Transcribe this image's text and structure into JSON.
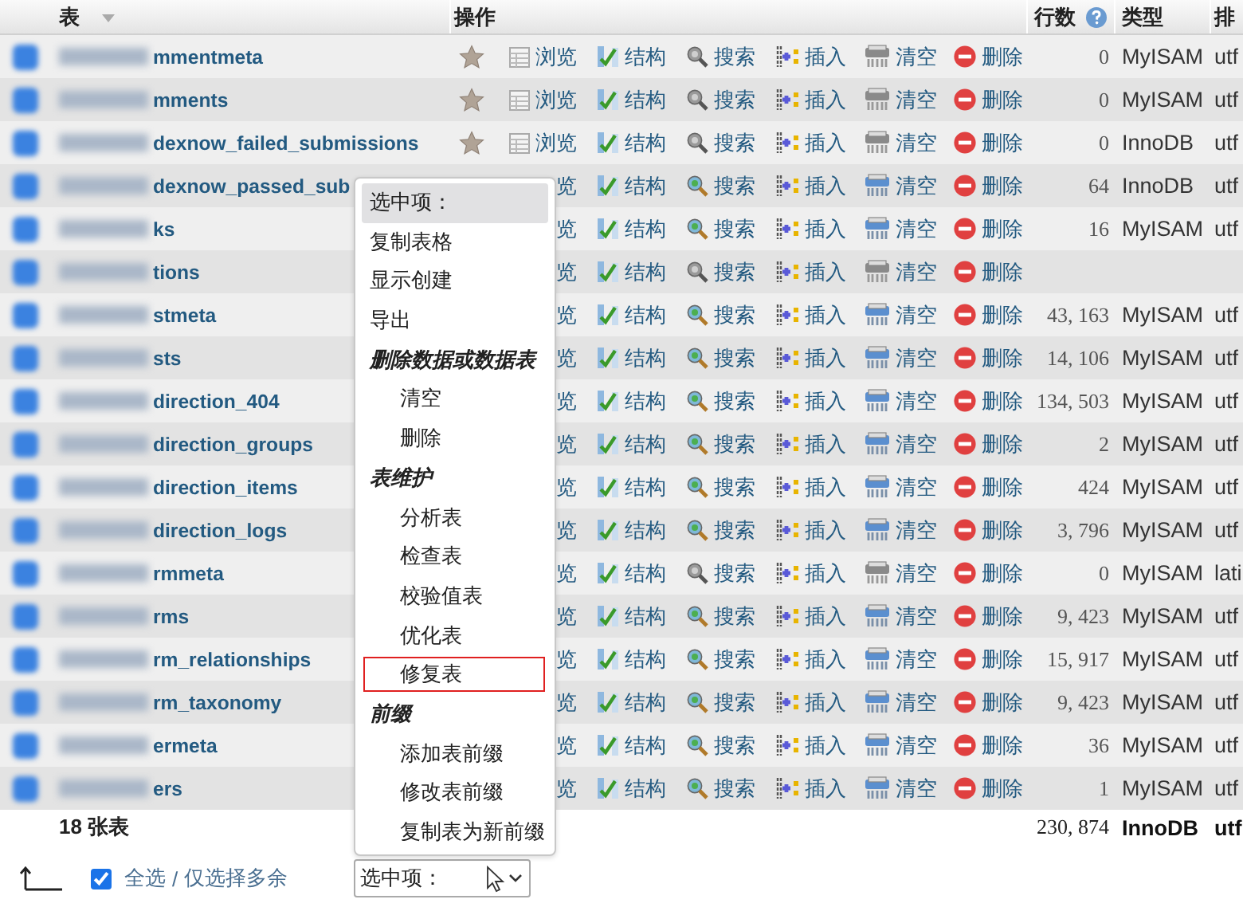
{
  "header": {
    "columns": [
      {
        "label": "表"
      },
      {
        "label": "操作"
      },
      {
        "label": "行数"
      },
      {
        "label": "类型"
      },
      {
        "label": "排"
      }
    ]
  },
  "rows": [
    {
      "name": "mmentmeta",
      "star_visible": true,
      "empty": true,
      "actions": [
        "浏览",
        "结构",
        "搜索",
        "插入",
        "清空",
        "删除"
      ],
      "count": "0",
      "type": "MyISAM",
      "collation": "utf"
    },
    {
      "name": "mments",
      "star_visible": true,
      "empty": true,
      "actions": [
        "浏览",
        "结构",
        "搜索",
        "插入",
        "清空",
        "删除"
      ],
      "count": "0",
      "type": "MyISAM",
      "collation": "utf"
    },
    {
      "name": "dexnow_failed_submissions",
      "star_visible": true,
      "empty": true,
      "actions": [
        "浏览",
        "结构",
        "搜索",
        "插入",
        "清空",
        "删除"
      ],
      "count": "0",
      "type": "InnoDB",
      "collation": "utf"
    },
    {
      "name": "dexnow_passed_sub",
      "star_visible": false,
      "empty": false,
      "actions": [
        "览",
        "结构",
        "搜索",
        "插入",
        "清空",
        "删除"
      ],
      "count": "64",
      "type": "InnoDB",
      "collation": "utf"
    },
    {
      "name": "ks",
      "star_visible": false,
      "empty": false,
      "actions": [
        "览",
        "结构",
        "搜索",
        "插入",
        "清空",
        "删除"
      ],
      "count": "16",
      "type": "MyISAM",
      "collation": "utf"
    },
    {
      "name": "tions",
      "star_visible": false,
      "empty": true,
      "actions": [
        "览",
        "结构",
        "搜索",
        "插入",
        "清空",
        "删除"
      ]
    },
    {
      "name": "stmeta",
      "star_visible": false,
      "empty": false,
      "actions": [
        "览",
        "结构",
        "搜索",
        "插入",
        "清空",
        "删除"
      ],
      "count": "43, 163",
      "type": "MyISAM",
      "collation": "utf"
    },
    {
      "name": "sts",
      "star_visible": false,
      "empty": false,
      "actions": [
        "览",
        "结构",
        "搜索",
        "插入",
        "清空",
        "删除"
      ],
      "count": "14, 106",
      "type": "MyISAM",
      "collation": "utf"
    },
    {
      "name": "direction_404",
      "star_visible": false,
      "empty": false,
      "actions": [
        "览",
        "结构",
        "搜索",
        "插入",
        "清空",
        "删除"
      ],
      "count": "134, 503",
      "type": "MyISAM",
      "collation": "utf"
    },
    {
      "name": "direction_groups",
      "star_visible": false,
      "empty": false,
      "actions": [
        "览",
        "结构",
        "搜索",
        "插入",
        "清空",
        "删除"
      ],
      "count": "2",
      "type": "MyISAM",
      "collation": "utf"
    },
    {
      "name": "direction_items",
      "star_visible": false,
      "empty": false,
      "actions": [
        "览",
        "结构",
        "搜索",
        "插入",
        "清空",
        "删除"
      ],
      "count": "424",
      "type": "MyISAM",
      "collation": "utf"
    },
    {
      "name": "direction_logs",
      "star_visible": false,
      "empty": false,
      "actions": [
        "览",
        "结构",
        "搜索",
        "插入",
        "清空",
        "删除"
      ],
      "count": "3, 796",
      "type": "MyISAM",
      "collation": "utf"
    },
    {
      "name": "rmmeta",
      "star_visible": false,
      "empty": true,
      "actions": [
        "览",
        "结构",
        "搜索",
        "插入",
        "清空",
        "删除"
      ],
      "count": "0",
      "type": "MyISAM",
      "collation": "lati"
    },
    {
      "name": "rms",
      "star_visible": false,
      "empty": false,
      "actions": [
        "览",
        "结构",
        "搜索",
        "插入",
        "清空",
        "删除"
      ],
      "count": "9, 423",
      "type": "MyISAM",
      "collation": "utf"
    },
    {
      "name": "rm_relationships",
      "star_visible": false,
      "empty": false,
      "actions": [
        "览",
        "结构",
        "搜索",
        "插入",
        "清空",
        "删除"
      ],
      "count": "15, 917",
      "type": "MyISAM",
      "collation": "utf"
    },
    {
      "name": "rm_taxonomy",
      "star_visible": false,
      "empty": false,
      "actions": [
        "览",
        "结构",
        "搜索",
        "插入",
        "清空",
        "删除"
      ],
      "count": "9, 423",
      "type": "MyISAM",
      "collation": "utf"
    },
    {
      "name": "ermeta",
      "star_visible": false,
      "empty": false,
      "actions": [
        "览",
        "结构",
        "搜索",
        "插入",
        "清空",
        "删除"
      ],
      "count": "36",
      "type": "MyISAM",
      "collation": "utf"
    },
    {
      "name": "ers",
      "star_visible": false,
      "empty": false,
      "actions": [
        "览",
        "结构",
        "搜索",
        "插入",
        "清空",
        "删除"
      ],
      "count": "1",
      "type": "MyISAM",
      "collation": "utf"
    }
  ],
  "footer": {
    "table_count": "18 张表",
    "total_rows": "230, 874",
    "engine": "InnoDB",
    "collation": "utf"
  },
  "menu": {
    "items": [
      {
        "kind": "option",
        "label": "选中项：",
        "selected": true
      },
      {
        "kind": "option",
        "label": "复制表格",
        "selected": false
      },
      {
        "kind": "option",
        "label": "显示创建",
        "selected": false
      },
      {
        "kind": "option",
        "label": "导出",
        "selected": false
      },
      {
        "kind": "group",
        "label": "删除数据或数据表",
        "children": [
          {
            "label": "清空",
            "selected": false,
            "marked": false
          },
          {
            "label": "删除",
            "selected": false,
            "marked": false
          }
        ]
      },
      {
        "kind": "group",
        "label": "表维护",
        "children": [
          {
            "label": "分析表",
            "selected": false,
            "marked": false
          },
          {
            "label": "检查表",
            "selected": false,
            "marked": false
          },
          {
            "label": "校验值表",
            "selected": false,
            "marked": false
          },
          {
            "label": "优化表",
            "selected": false,
            "marked": false
          },
          {
            "label": "修复表",
            "selected": false,
            "marked": true
          }
        ]
      },
      {
        "kind": "group",
        "label": "前缀",
        "children": [
          {
            "label": "添加表前缀",
            "selected": false,
            "marked": false
          },
          {
            "label": "修改表前缀",
            "selected": false,
            "marked": false
          },
          {
            "label": "复制表为新前缀",
            "selected": false,
            "marked": false
          }
        ]
      }
    ]
  },
  "bottom": {
    "select_all": {
      "checked": true,
      "label": "全选",
      "separator": "/",
      "link": "仅选择多余"
    },
    "with_selected": {
      "value": "选中项："
    }
  }
}
